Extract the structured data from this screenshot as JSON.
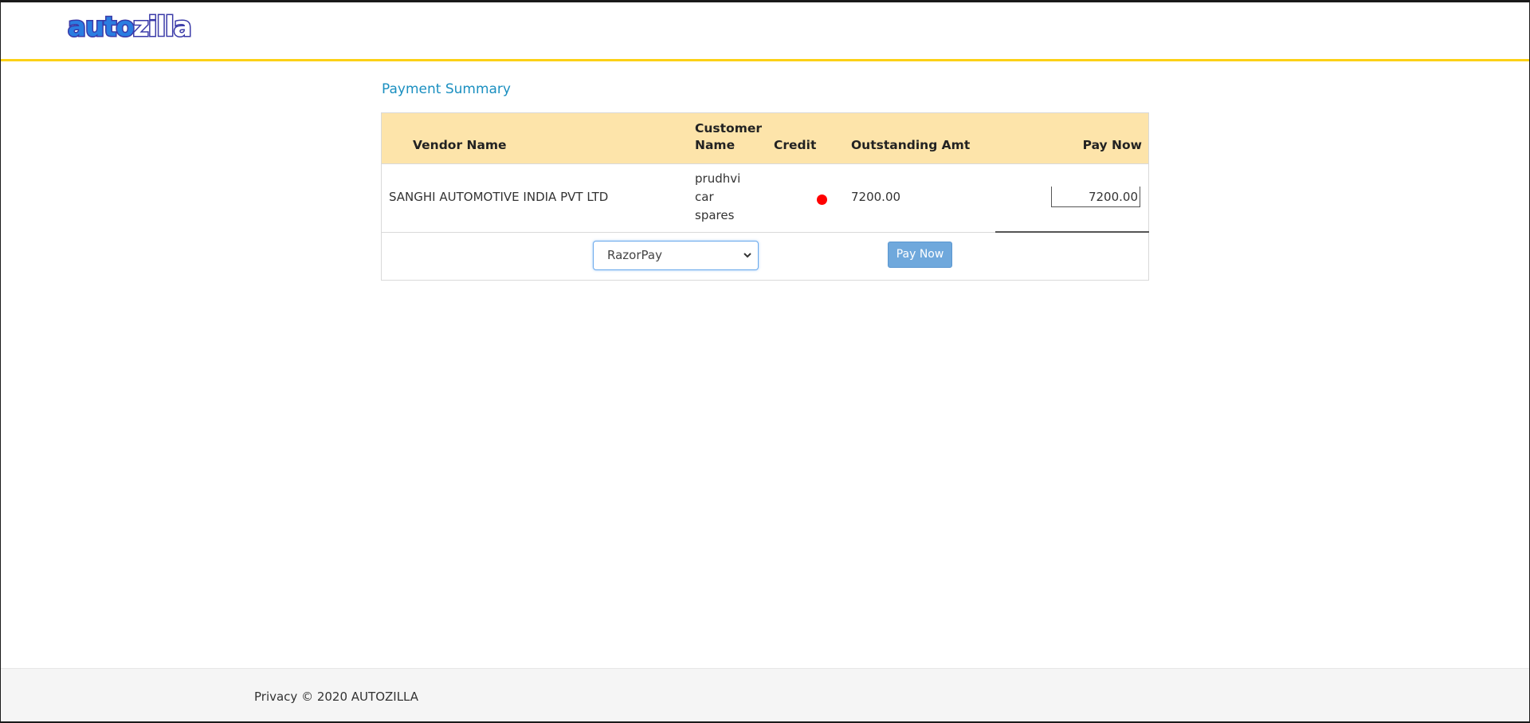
{
  "header": {
    "logo_text": "autozilla",
    "colors": {
      "accent_line": "#fcd116",
      "logo_blue": "#2a7de1",
      "logo_dark": "#3a3aa8"
    }
  },
  "main": {
    "title": "Payment Summary",
    "table": {
      "headers": {
        "vendor": "Vendor Name",
        "customer_line1": "Customer",
        "customer_line2": "Name",
        "credit": "Credit",
        "outstanding": "Outstanding Amt",
        "pay_now": "Pay Now"
      },
      "rows": [
        {
          "vendor": "SANGHI AUTOMOTIVE INDIA PVT LTD",
          "customer_line1": "prudhvi",
          "customer_line2": "car",
          "customer_line3": "spares",
          "credit_status_color": "#ff0000",
          "outstanding": "7200.00",
          "pay_now_value": "7200.00"
        }
      ]
    },
    "payment_method": {
      "selected": "RazorPay"
    },
    "pay_button_label": "Pay Now"
  },
  "footer": {
    "text": "Privacy © 2020 AUTOZILLA"
  }
}
